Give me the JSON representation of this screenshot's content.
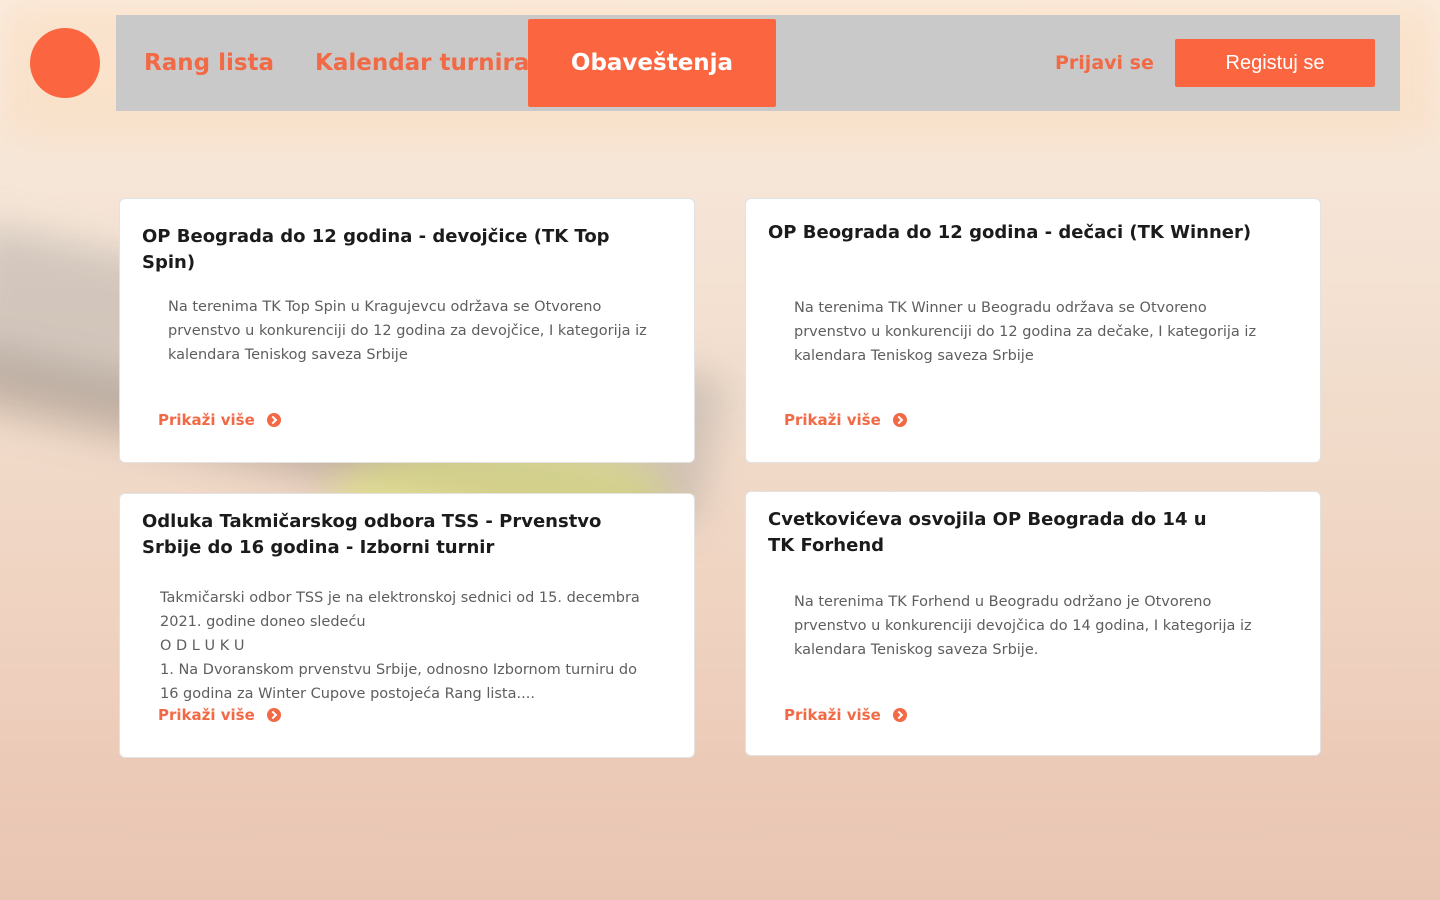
{
  "nav": {
    "items": [
      "Rang lista",
      "Kalendar turnira",
      "Obaveštenja"
    ],
    "active": "Obaveštenja",
    "login_label": "Prijavi se",
    "register_label": "Registuj se"
  },
  "colors": {
    "accent": "#fb6641",
    "navbar_bg": "#c9c9c9",
    "card_bg": "#ffffff",
    "link": "#f26a45"
  },
  "icons": {
    "more": "chevron-circle-right-icon"
  },
  "cards": [
    {
      "title": "OP Beograda do 12 godina - devojčice (TK Top Spin)",
      "text": "Na terenima TK Top Spin u Kragujevcu održava se Otvoreno prvenstvo u konkurenciji do 12 godina za devojčice, I kategorija iz kalendara Teniskog saveza Srbije",
      "more_label": "Prikaži više"
    },
    {
      "title": "OP Beograda do 12 godina - dečaci (TK Winner)",
      "text": "Na terenima TK Winner u Beogradu održava se Otvoreno prvenstvo u konkurenciji do 12 godina za dečake, I kategorija iz kalendara Teniskog saveza Srbije",
      "more_label": "Prikaži više"
    },
    {
      "title": "Odluka Takmičarskog odbora TSS - Prvenstvo Srbije do 16 godina - Izborni turnir",
      "text": "Takmičarski odbor TSS je na elektronskoj sednici od 15. decembra 2021. godine doneo sledeću\nO D L U K U\n1. Na Dvoranskom prvenstvu Srbije, odnosno Izbornom turniru do 16 godina za Winter Cupove postojeća Rang lista....",
      "more_label": "Prikaži više"
    },
    {
      "title": "Cvetkovićeva osvojila OP Beograda do 14 u TK Forhend",
      "text": "Na terenima TK Forhend u Beogradu održano je Otvoreno prvenstvo u konkurenciji devojčica do 14 godina, I kategorija iz kalendara Teniskog saveza Srbije.",
      "more_label": "Prikaži više"
    }
  ]
}
